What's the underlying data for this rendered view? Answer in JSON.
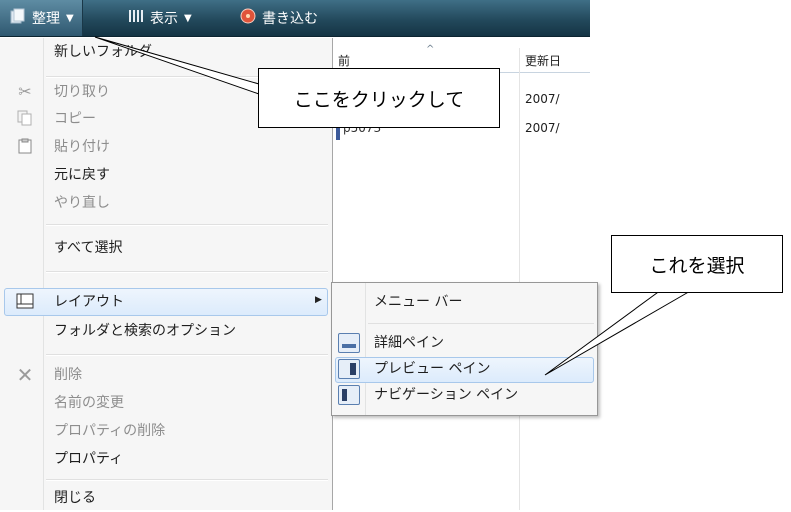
{
  "toolbar": {
    "organize_label": "整理",
    "view_label": "表示",
    "burn_label": "書き込む"
  },
  "background": {
    "col_name_fragment": "前",
    "col_date_fragment": "更新日",
    "file_fragment": "p5073",
    "dates": [
      "2007/",
      "2007/"
    ]
  },
  "menu": {
    "items": [
      {
        "label": "新しいフォルダ",
        "enabled": true
      },
      {
        "label": "切り取り",
        "enabled": false,
        "icon": "scissors-icon"
      },
      {
        "label": "コピー",
        "enabled": false,
        "icon": "copy-icon"
      },
      {
        "label": "貼り付け",
        "enabled": false,
        "icon": "paste-icon"
      },
      {
        "label": "元に戻す",
        "enabled": true
      },
      {
        "label": "やり直し",
        "enabled": false
      },
      {
        "label": "すべて選択",
        "enabled": true
      },
      {
        "label": "レイアウト",
        "enabled": true,
        "icon": "layout-icon",
        "has_submenu": true
      },
      {
        "label": "フォルダと検索のオプション",
        "enabled": true
      },
      {
        "label": "削除",
        "enabled": false,
        "icon": "delete-icon"
      },
      {
        "label": "名前の変更",
        "enabled": false
      },
      {
        "label": "プロパティの削除",
        "enabled": false
      },
      {
        "label": "プロパティ",
        "enabled": true
      },
      {
        "label": "閉じる",
        "enabled": true
      }
    ]
  },
  "layout_submenu": {
    "items": [
      {
        "label": "メニュー バー",
        "checked": false
      },
      {
        "label": "詳細ペイン",
        "checked": true
      },
      {
        "label": "プレビュー ペイン",
        "checked": true
      },
      {
        "label": "ナビゲーション ペイン",
        "checked": true
      }
    ]
  },
  "callouts": {
    "click_here": "ここをクリックして",
    "select_this": "これを選択"
  },
  "colors": {
    "toolbar": "#23495c",
    "menu_bg": "#f6f6f6",
    "highlight": "#dcebfc",
    "highlight_border": "#a8c8eb"
  }
}
